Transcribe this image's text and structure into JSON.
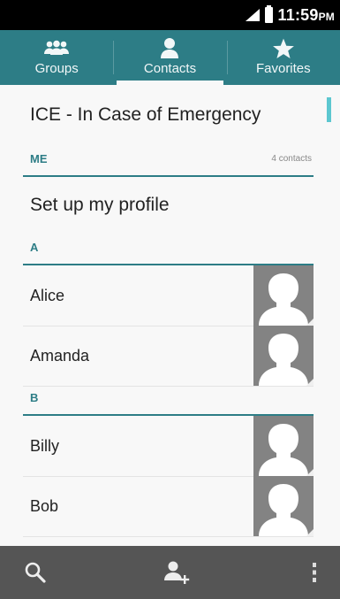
{
  "status": {
    "time": "11:59",
    "ampm": "PM"
  },
  "tabs": [
    {
      "label": "Groups",
      "icon": "groups-icon"
    },
    {
      "label": "Contacts",
      "icon": "contact-person-icon",
      "active": true
    },
    {
      "label": "Favorites",
      "icon": "star-icon"
    }
  ],
  "list": {
    "ice_label": "ICE - In Case of Emergency",
    "me_header": "ME",
    "contacts_count": "4 contacts",
    "setup_profile": "Set up my profile",
    "sections": [
      {
        "letter": "A",
        "contacts": [
          "Alice",
          "Amanda"
        ]
      },
      {
        "letter": "B",
        "contacts": [
          "Billy",
          "Bob"
        ]
      }
    ]
  },
  "bottom_bar": {
    "icons": [
      "search-icon",
      "add-contact-icon",
      "overflow-menu-icon"
    ]
  },
  "colors": {
    "accent": "#2d7d86",
    "scroll": "#5cc7d0",
    "avatar_bg": "#838383",
    "bottom_bar": "#555555"
  }
}
